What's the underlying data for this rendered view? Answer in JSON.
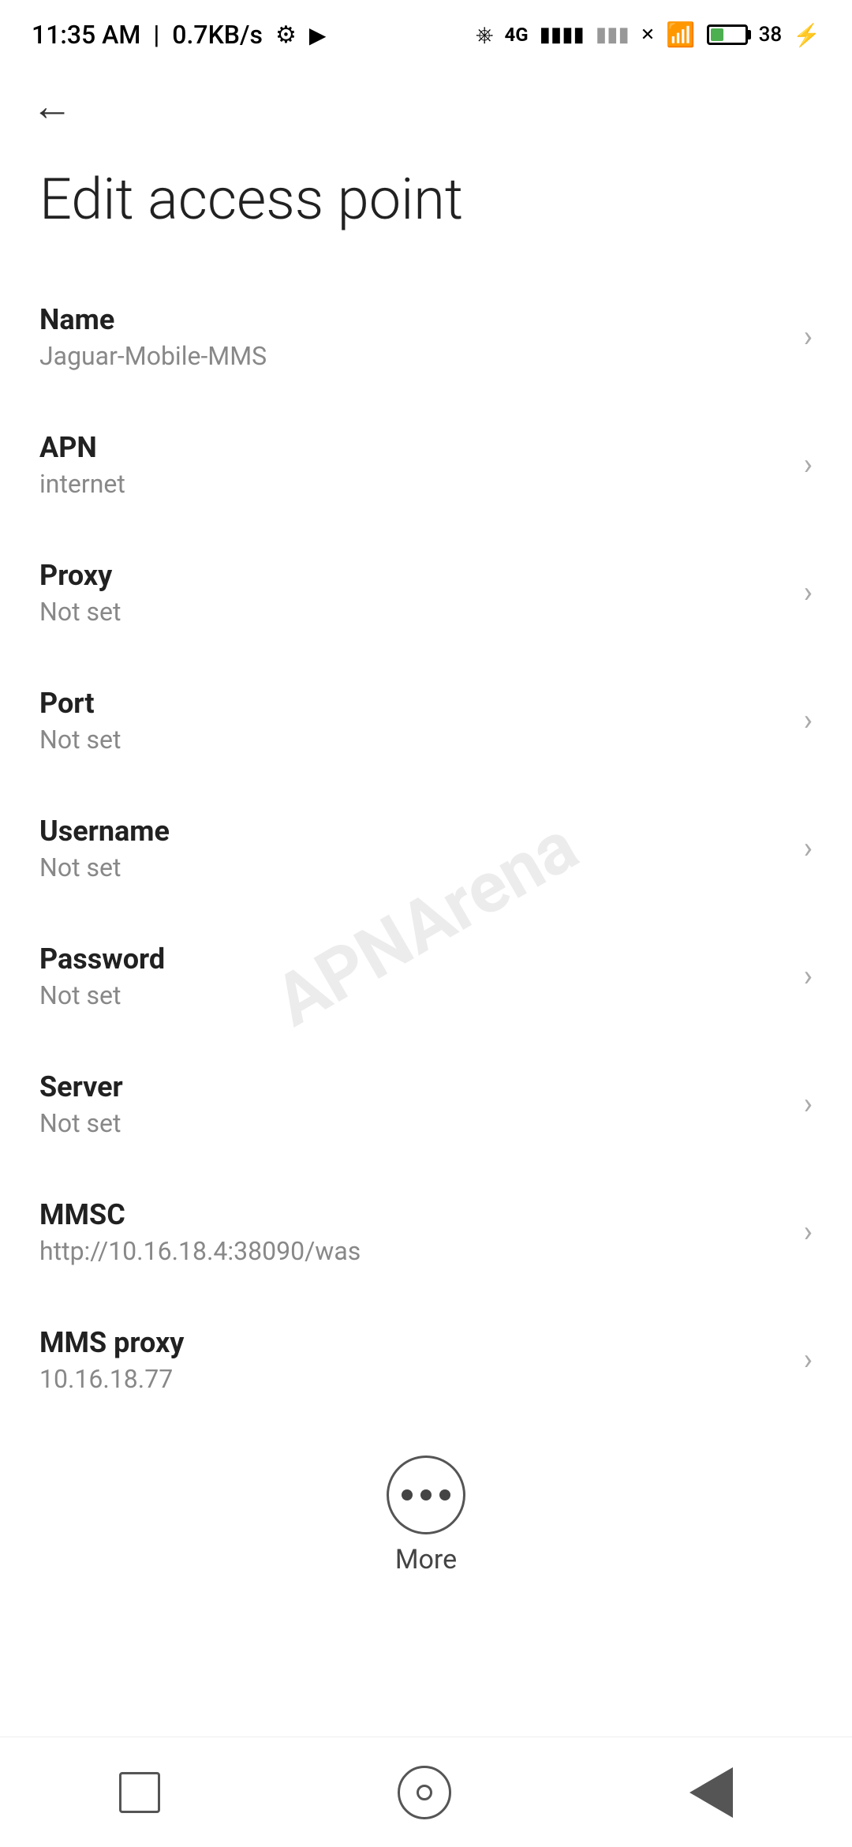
{
  "statusBar": {
    "time": "11:35 AM",
    "speed": "0.7KB/s",
    "batteryPercent": "38"
  },
  "navigation": {
    "backLabel": "←"
  },
  "pageTitle": "Edit access point",
  "settings": [
    {
      "label": "Name",
      "value": "Jaguar-Mobile-MMS"
    },
    {
      "label": "APN",
      "value": "internet"
    },
    {
      "label": "Proxy",
      "value": "Not set"
    },
    {
      "label": "Port",
      "value": "Not set"
    },
    {
      "label": "Username",
      "value": "Not set"
    },
    {
      "label": "Password",
      "value": "Not set"
    },
    {
      "label": "Server",
      "value": "Not set"
    },
    {
      "label": "MMSC",
      "value": "http://10.16.18.4:38090/was"
    },
    {
      "label": "MMS proxy",
      "value": "10.16.18.77"
    }
  ],
  "moreButton": {
    "label": "More"
  },
  "watermark": "APNArena"
}
